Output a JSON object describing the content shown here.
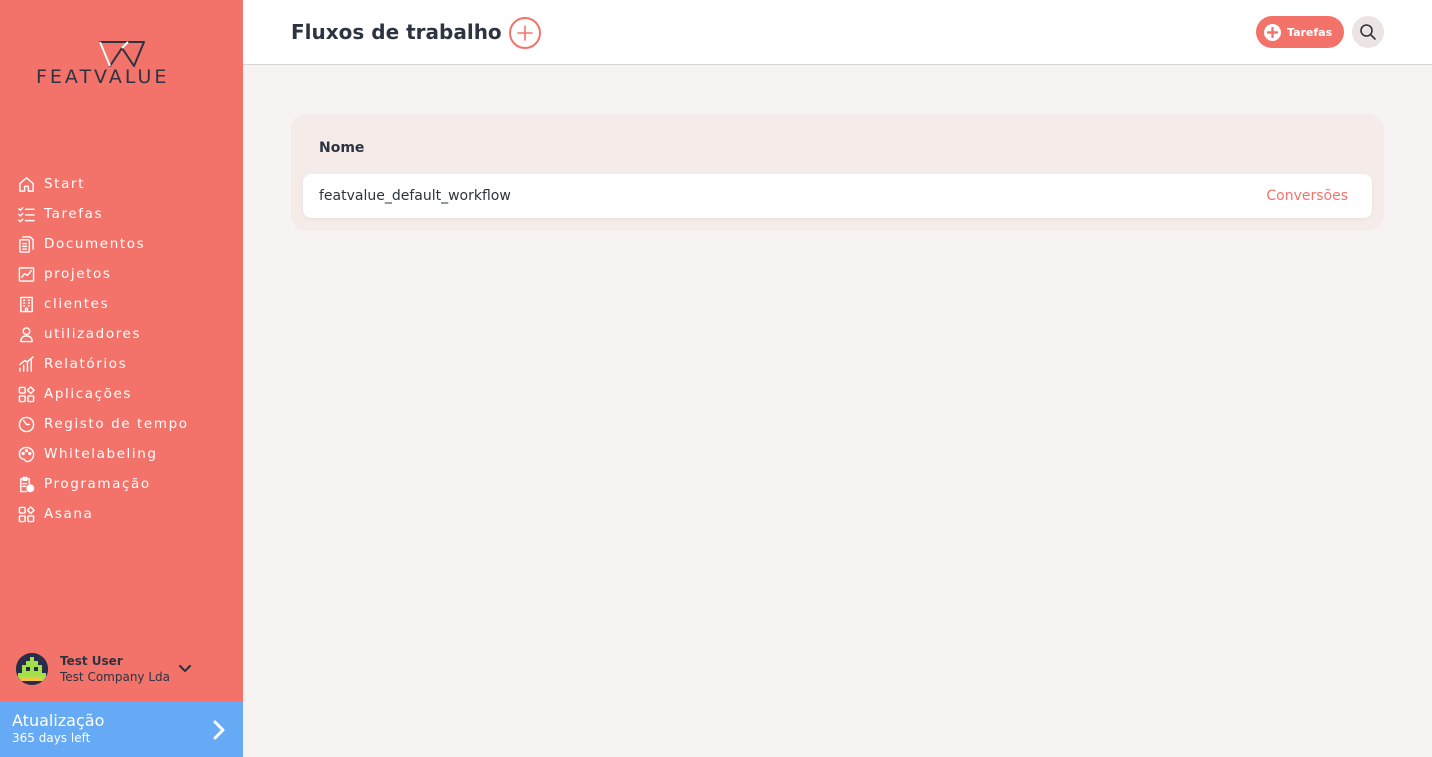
{
  "brand": {
    "logo_text": "FEATVALUE",
    "accent_color": "#f3736a",
    "upgrade_color": "#66aaf5"
  },
  "sidebar": {
    "items": [
      {
        "label": "Start",
        "icon": "home-icon"
      },
      {
        "label": "Tarefas",
        "icon": "checklist-icon"
      },
      {
        "label": "Documentos",
        "icon": "documents-icon"
      },
      {
        "label": "projetos",
        "icon": "projects-chart-icon"
      },
      {
        "label": "clientes",
        "icon": "building-icon"
      },
      {
        "label": "utilizadores",
        "icon": "user-icon"
      },
      {
        "label": "Relatórios",
        "icon": "bar-chart-icon"
      },
      {
        "label": "Aplicações",
        "icon": "apps-grid-icon"
      },
      {
        "label": "Registo de tempo",
        "icon": "timer-icon"
      },
      {
        "label": "Whitelabeling",
        "icon": "palette-icon"
      },
      {
        "label": "Programação",
        "icon": "clipboard-clock-icon"
      },
      {
        "label": "Asana",
        "icon": "apps-grid-icon"
      }
    ],
    "user": {
      "name": "Test User",
      "company": "Test Company Lda"
    },
    "upgrade": {
      "title": "Atualização",
      "subtitle": "365 days left"
    }
  },
  "header": {
    "title": "Fluxos de trabalho",
    "tasks_button": "Tarefas"
  },
  "table": {
    "column_name": "Nome",
    "rows": [
      {
        "name": "featvalue_default_workflow",
        "action": "Conversões"
      }
    ]
  }
}
